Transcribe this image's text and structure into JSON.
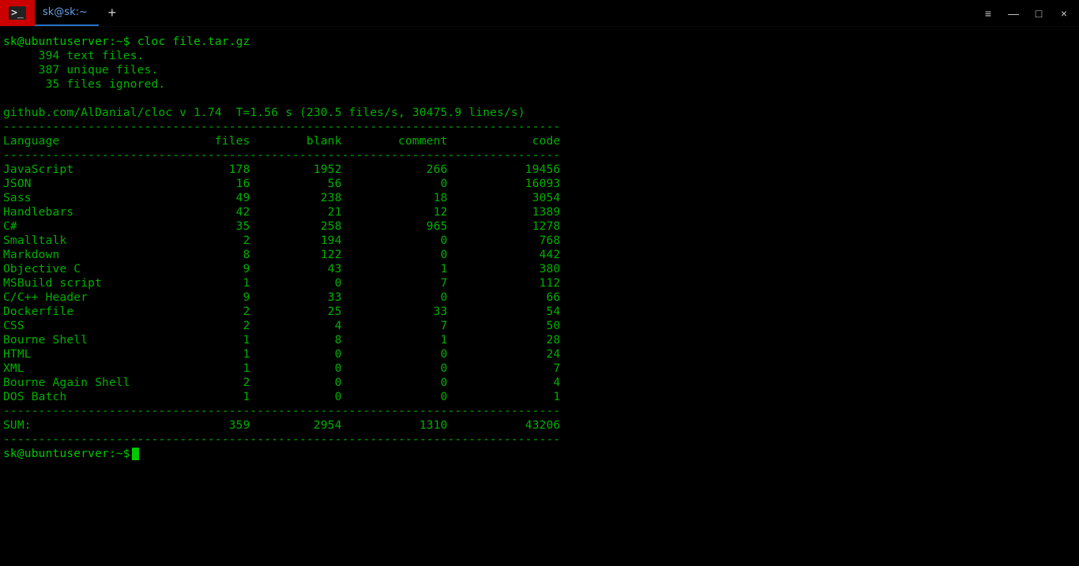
{
  "titlebar": {
    "tab_title": "sk@sk:~",
    "new_tab": "+",
    "menu": "≡",
    "minimize": "—",
    "maximize": "□",
    "close": "×"
  },
  "session": {
    "prompt": "sk@ubuntuserver:~$",
    "command": "cloc file.tar.gz",
    "summary_lines": [
      "     394 text files.",
      "     387 unique files.",
      "      35 files ignored."
    ],
    "meta_line": "github.com/AlDanial/cloc v 1.74  T=1.56 s (230.5 files/s, 30475.9 lines/s)",
    "divider": "-------------------------------------------------------------------------------",
    "header": {
      "lang": "Language",
      "files": "files",
      "blank": "blank",
      "comment": "comment",
      "code": "code"
    },
    "rows": [
      {
        "lang": "JavaScript",
        "files": "178",
        "blank": "1952",
        "comment": "266",
        "code": "19456"
      },
      {
        "lang": "JSON",
        "files": "16",
        "blank": "56",
        "comment": "0",
        "code": "16093"
      },
      {
        "lang": "Sass",
        "files": "49",
        "blank": "238",
        "comment": "18",
        "code": "3054"
      },
      {
        "lang": "Handlebars",
        "files": "42",
        "blank": "21",
        "comment": "12",
        "code": "1389"
      },
      {
        "lang": "C#",
        "files": "35",
        "blank": "258",
        "comment": "965",
        "code": "1278"
      },
      {
        "lang": "Smalltalk",
        "files": "2",
        "blank": "194",
        "comment": "0",
        "code": "768"
      },
      {
        "lang": "Markdown",
        "files": "8",
        "blank": "122",
        "comment": "0",
        "code": "442"
      },
      {
        "lang": "Objective C",
        "files": "9",
        "blank": "43",
        "comment": "1",
        "code": "380"
      },
      {
        "lang": "MSBuild script",
        "files": "1",
        "blank": "0",
        "comment": "7",
        "code": "112"
      },
      {
        "lang": "C/C++ Header",
        "files": "9",
        "blank": "33",
        "comment": "0",
        "code": "66"
      },
      {
        "lang": "Dockerfile",
        "files": "2",
        "blank": "25",
        "comment": "33",
        "code": "54"
      },
      {
        "lang": "CSS",
        "files": "2",
        "blank": "4",
        "comment": "7",
        "code": "50"
      },
      {
        "lang": "Bourne Shell",
        "files": "1",
        "blank": "8",
        "comment": "1",
        "code": "28"
      },
      {
        "lang": "HTML",
        "files": "1",
        "blank": "0",
        "comment": "0",
        "code": "24"
      },
      {
        "lang": "XML",
        "files": "1",
        "blank": "0",
        "comment": "0",
        "code": "7"
      },
      {
        "lang": "Bourne Again Shell",
        "files": "2",
        "blank": "0",
        "comment": "0",
        "code": "4"
      },
      {
        "lang": "DOS Batch",
        "files": "1",
        "blank": "0",
        "comment": "0",
        "code": "1"
      }
    ],
    "sum": {
      "lang": "SUM:",
      "files": "359",
      "blank": "2954",
      "comment": "1310",
      "code": "43206"
    }
  },
  "chart_data": {
    "type": "table",
    "title": "cloc file.tar.gz",
    "columns": [
      "Language",
      "files",
      "blank",
      "comment",
      "code"
    ],
    "rows": [
      [
        "JavaScript",
        178,
        1952,
        266,
        19456
      ],
      [
        "JSON",
        16,
        56,
        0,
        16093
      ],
      [
        "Sass",
        49,
        238,
        18,
        3054
      ],
      [
        "Handlebars",
        42,
        21,
        12,
        1389
      ],
      [
        "C#",
        35,
        258,
        965,
        1278
      ],
      [
        "Smalltalk",
        2,
        194,
        0,
        768
      ],
      [
        "Markdown",
        8,
        122,
        0,
        442
      ],
      [
        "Objective C",
        9,
        43,
        1,
        380
      ],
      [
        "MSBuild script",
        1,
        0,
        7,
        112
      ],
      [
        "C/C++ Header",
        9,
        33,
        0,
        66
      ],
      [
        "Dockerfile",
        2,
        25,
        33,
        54
      ],
      [
        "CSS",
        2,
        4,
        7,
        50
      ],
      [
        "Bourne Shell",
        1,
        8,
        1,
        28
      ],
      [
        "HTML",
        1,
        0,
        0,
        24
      ],
      [
        "XML",
        1,
        0,
        0,
        7
      ],
      [
        "Bourne Again Shell",
        2,
        0,
        0,
        4
      ],
      [
        "DOS Batch",
        1,
        0,
        0,
        1
      ]
    ],
    "totals": {
      "files": 359,
      "blank": 2954,
      "comment": 1310,
      "code": 43206
    }
  }
}
